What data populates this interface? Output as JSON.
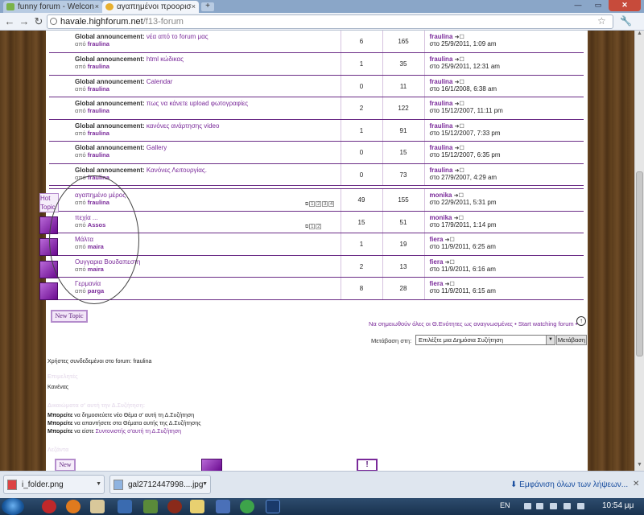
{
  "browser": {
    "tabs": [
      {
        "title": "funny forum - Welcon"
      },
      {
        "title": "αγαπημένοι προορισ"
      }
    ],
    "url_host": "havale.highforum.net",
    "url_path": "/f13-forum"
  },
  "forum": {
    "announcements": [
      {
        "prefix": "Global announcement:",
        "title": "νέα από το forum μας",
        "by_label": "από",
        "author": "fraulina",
        "replies": "6",
        "views": "165",
        "last_user": "fraulina",
        "last_date": "στο 25/9/2011, 1:09 am"
      },
      {
        "prefix": "Global announcement:",
        "title": "html κώδικας",
        "by_label": "από",
        "author": "fraulina",
        "replies": "1",
        "views": "35",
        "last_user": "fraulina",
        "last_date": "στο 25/9/2011, 12:31 am"
      },
      {
        "prefix": "Global announcement:",
        "title": "Calendar",
        "by_label": "από",
        "author": "fraulina",
        "replies": "0",
        "views": "11",
        "last_user": "fraulina",
        "last_date": "στο 16/1/2008, 6:38 am"
      },
      {
        "prefix": "Global announcement:",
        "title": "πως να κάνετε upload φωτογραφίες",
        "by_label": "από",
        "author": "fraulina",
        "replies": "2",
        "views": "122",
        "last_user": "fraulina",
        "last_date": "στο 15/12/2007, 11:11 pm"
      },
      {
        "prefix": "Global announcement:",
        "title": "κανόνες ανάρτησης video",
        "by_label": "από",
        "author": "fraulina",
        "replies": "1",
        "views": "91",
        "last_user": "fraulina",
        "last_date": "στο 15/12/2007, 7:33 pm"
      },
      {
        "prefix": "Global announcement:",
        "title": "Gallery",
        "by_label": "από",
        "author": "fraulina",
        "replies": "0",
        "views": "15",
        "last_user": "fraulina",
        "last_date": "στο 15/12/2007, 6:35 pm"
      },
      {
        "prefix": "Global announcement:",
        "title": "Κανόνες Λειτουργίας.",
        "by_label": "από",
        "author": "fraulina",
        "replies": "0",
        "views": "73",
        "last_user": "fraulina",
        "last_date": "στο 27/9/2007, 4:29 am"
      }
    ],
    "topics": [
      {
        "hot_label": "Hot Topic",
        "title": "αγαπημένο μέρος",
        "by_label": "από",
        "author": "fraulina",
        "pages": [
          "1",
          "2",
          "3",
          "4"
        ],
        "replies": "49",
        "views": "155",
        "last_user": "monika",
        "last_date": "στο 22/9/2011, 5:31 pm"
      },
      {
        "title": "πεχία ...",
        "by_label": "από",
        "author": "Assos",
        "pages": [
          "1",
          "2"
        ],
        "replies": "15",
        "views": "51",
        "last_user": "monika",
        "last_date": "στο 17/9/2011, 1:14 pm"
      },
      {
        "title": "Μάλτα",
        "by_label": "από",
        "author": "maira",
        "pages": [],
        "replies": "1",
        "views": "19",
        "last_user": "fiera",
        "last_date": "στο 11/9/2011, 6:25 am"
      },
      {
        "title": "Ουγγαρια Βουδαπεστη",
        "by_label": "από",
        "author": "maira",
        "pages": [],
        "replies": "2",
        "views": "13",
        "last_user": "fiera",
        "last_date": "στο 11/9/2011, 6:16 am"
      },
      {
        "title": "Γερμανία",
        "by_label": "από",
        "author": "parga",
        "pages": [],
        "replies": "8",
        "views": "28",
        "last_user": "fiera",
        "last_date": "στο 11/9/2011, 6:15 am"
      }
    ],
    "new_topic_label": "New Topic",
    "mark_read": "Να σημειωθούν όλες οι Θ.Ενότητες ως αναγνωσμένες • Start watching forum •",
    "jump_label": "Μετάβαση στη:",
    "jump_value": "Επιλέξτε μια Δημόσια Συζήτηση",
    "jump_button": "Μετάβαση",
    "online_text": "Χρήστες συνδεδεμένοι στο forum: fraulina",
    "section_moderators": "Επιμελητές",
    "moderators_value": "Κανένας",
    "section_permissions": "Δικαιώματα σ' αυτή την Δ.Συζήτηση:",
    "perm_verb": "Μπορείτε",
    "perm_1": "να δημοσιεύετε νέο Θέμα σ' αυτή τη Δ.Συζήτηση",
    "perm_2": "να απαντήσετε στα Θέματα αυτής της Δ.Συζήτησης",
    "perm_3_prefix": "να είστε",
    "perm_3_link": "Συντονιστής σ'αυτή τη Δ.Συζήτηση",
    "section_legend": "Λεζάντα",
    "legend_new": "New",
    "legend_excl": "!"
  },
  "downloads": {
    "items": [
      "i_folder.png",
      "gal2712447998....jpg"
    ],
    "show_all": "Εμφάνιση όλων των λήψεων..."
  },
  "taskbar": {
    "lang": "EN",
    "clock": "10:54 μμ"
  },
  "colors": {
    "accent": "#7a2a9a",
    "row_border": "#6b2c86",
    "icon_purple": "#6a0a8f"
  }
}
